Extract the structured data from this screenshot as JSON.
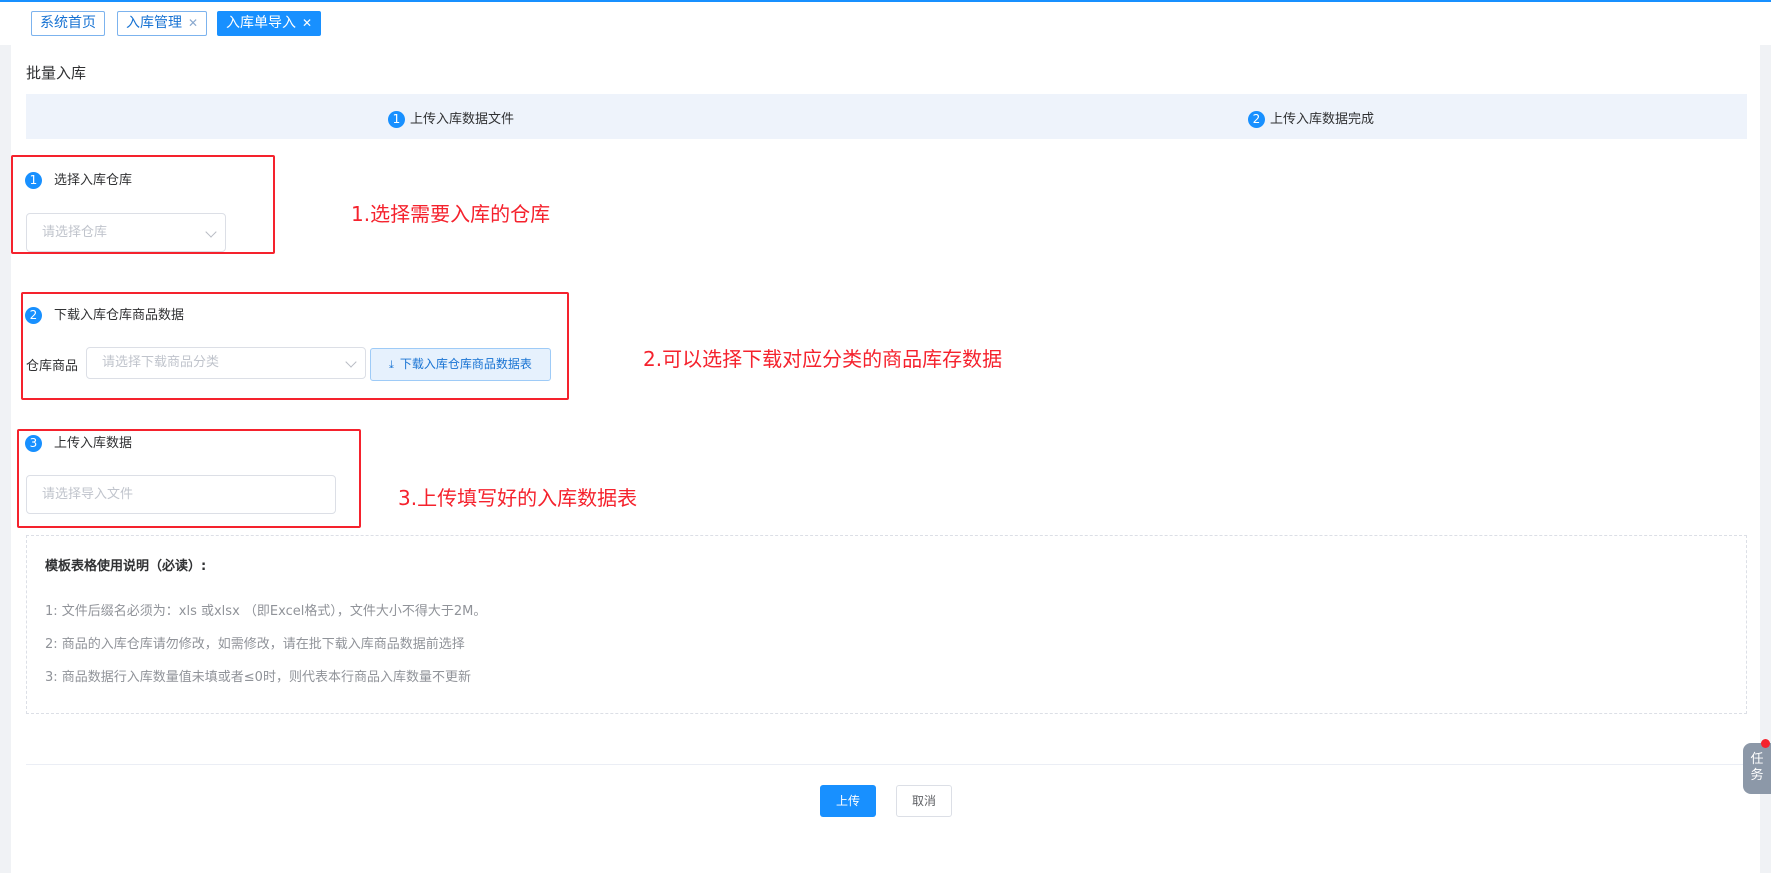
{
  "tabs": [
    {
      "label": "系统首页",
      "closable": false,
      "active": false
    },
    {
      "label": "入库管理",
      "closable": true,
      "active": false
    },
    {
      "label": "入库单导入",
      "closable": true,
      "active": true
    }
  ],
  "page": {
    "title": "批量入库"
  },
  "steps": [
    {
      "num": "1",
      "label": "上传入库数据文件"
    },
    {
      "num": "2",
      "label": "上传入库数据完成"
    }
  ],
  "sections": {
    "warehouse": {
      "num": "1",
      "title": "选择入库仓库",
      "placeholder": "请选择仓库"
    },
    "download": {
      "num": "2",
      "title": "下载入库仓库商品数据",
      "field_label": "仓库商品",
      "placeholder": "请选择下载商品分类",
      "button": "下载入库仓库商品数据表"
    },
    "upload": {
      "num": "3",
      "title": "上传入库数据",
      "placeholder": "请选择导入文件"
    }
  },
  "annotations": [
    "1.选择需要入库的仓库",
    "2.可以选择下载对应分类的商品库存数据",
    "3.上传填写好的入库数据表"
  ],
  "instructions": {
    "title": "模板表格使用说明（必读）:",
    "lines": [
      "1: 文件后缀名必须为：xls 或xlsx （即Excel格式），文件大小不得大于2M。",
      "2: 商品的入库仓库请勿修改，如需修改，请在批下载入库商品数据前选择",
      "3: 商品数据行入库数量值未填或者≤0时，则代表本行商品入库数量不更新"
    ]
  },
  "actions": {
    "submit": "上传",
    "cancel": "取消"
  },
  "task_widget": {
    "line1": "任",
    "line2": "务"
  },
  "colors": {
    "primary": "#1890ff",
    "annotation": "#f5222d"
  }
}
